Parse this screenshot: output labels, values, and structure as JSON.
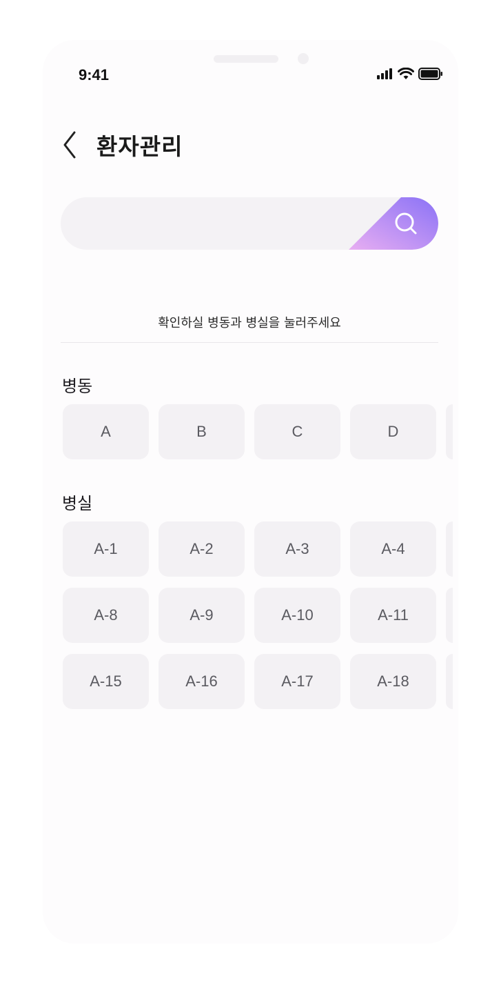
{
  "status_bar": {
    "time": "9:41"
  },
  "header": {
    "title": "환자관리"
  },
  "search": {
    "placeholder": ""
  },
  "hint": "확인하실 병동과 병실을 눌러주세요",
  "ward_section": {
    "label": "병동",
    "items": [
      "A",
      "B",
      "C",
      "D"
    ]
  },
  "room_section": {
    "label": "병실",
    "rows": [
      [
        "A-1",
        "A-2",
        "A-3",
        "A-4"
      ],
      [
        "A-8",
        "A-9",
        "A-10",
        "A-11"
      ],
      [
        "A-15",
        "A-16",
        "A-17",
        "A-18"
      ]
    ]
  },
  "colors": {
    "accent_start": "#e3a8f3",
    "accent_end": "#8c74f7",
    "chip_bg": "#f3f1f4",
    "search_bg": "#f4f2f5"
  },
  "icons": [
    "back-chevron-icon",
    "search-icon",
    "cellular-signal-icon",
    "wifi-icon",
    "battery-icon"
  ]
}
